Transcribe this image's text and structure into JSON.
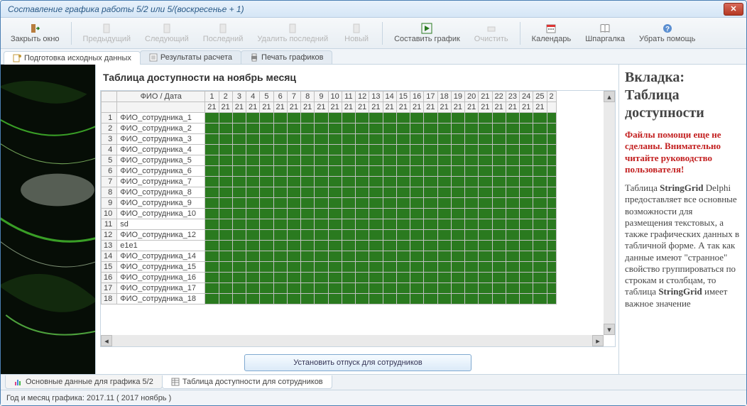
{
  "window": {
    "title": "Составление графика работы 5/2 или 5/(воскресенье + 1)"
  },
  "toolbar": {
    "close": {
      "label": "Закрыть окно"
    },
    "prev": {
      "label": "Предыдущий"
    },
    "next": {
      "label": "Следующий"
    },
    "last": {
      "label": "Последний"
    },
    "dellast": {
      "label": "Удалить последний"
    },
    "new": {
      "label": "Новый"
    },
    "compose": {
      "label": "Составить график"
    },
    "clear": {
      "label": "Очистить"
    },
    "calendar": {
      "label": "Календарь"
    },
    "cheat": {
      "label": "Шпаргалка"
    },
    "hidehelp": {
      "label": "Убрать помощь"
    }
  },
  "toptabs": {
    "t1": "Подготовка исходных данных",
    "t2": "Результаты расчета",
    "t3": "Печать графиков"
  },
  "tableTitle": "Таблица доступности на ноябрь месяц",
  "fioHeader": "ФИО / Дата",
  "dayStart": 1,
  "dayEnd": 25,
  "subHeaderCell": "21",
  "rows": [
    {
      "n": 1,
      "fio": "ФИО_сотрудника_1"
    },
    {
      "n": 2,
      "fio": "ФИО_сотрудника_2"
    },
    {
      "n": 3,
      "fio": "ФИО_сотрудника_3"
    },
    {
      "n": 4,
      "fio": "ФИО_сотрудника_4"
    },
    {
      "n": 5,
      "fio": "ФИО_сотрудника_5"
    },
    {
      "n": 6,
      "fio": "ФИО_сотрудника_6"
    },
    {
      "n": 7,
      "fio": "ФИО_сотрудника_7"
    },
    {
      "n": 8,
      "fio": "ФИО_сотрудника_8"
    },
    {
      "n": 9,
      "fio": "ФИО_сотрудника_9"
    },
    {
      "n": 10,
      "fio": "ФИО_сотрудника_10"
    },
    {
      "n": 11,
      "fio": "sd"
    },
    {
      "n": 12,
      "fio": "ФИО_сотрудника_12"
    },
    {
      "n": 13,
      "fio": "e1e1"
    },
    {
      "n": 14,
      "fio": "ФИО_сотрудника_14"
    },
    {
      "n": 15,
      "fio": "ФИО_сотрудника_15"
    },
    {
      "n": 16,
      "fio": "ФИО_сотрудника_16"
    },
    {
      "n": 17,
      "fio": "ФИО_сотрудника_17"
    },
    {
      "n": 18,
      "fio": "ФИО_сотрудника_18"
    }
  ],
  "bigButton": "Установить отпуск для сотрудников",
  "help": {
    "title": "Вкладка: Таблица доступности",
    "warn": "Файлы помощи еще не сделаны. Внимательно читайте руководство пользователя!",
    "body1": "Таблица ",
    "bold1": "StringGrid",
    "body2": " Delphi предоставляет все основные возможности для размещения текстовых, а также графических данных в табличной форме. А так как данные имеют \"странное\" свойство группироваться по строкам и столбцам, то таблица ",
    "bold2": "StringGrid",
    "body3": " имеет важное значение"
  },
  "bottabs": {
    "b1": "Основные данные для графика 5/2",
    "b2": "Таблица доступности для сотрудников"
  },
  "status": "Год и месяц графика:  2017.11  ( 2017  ноябрь )"
}
